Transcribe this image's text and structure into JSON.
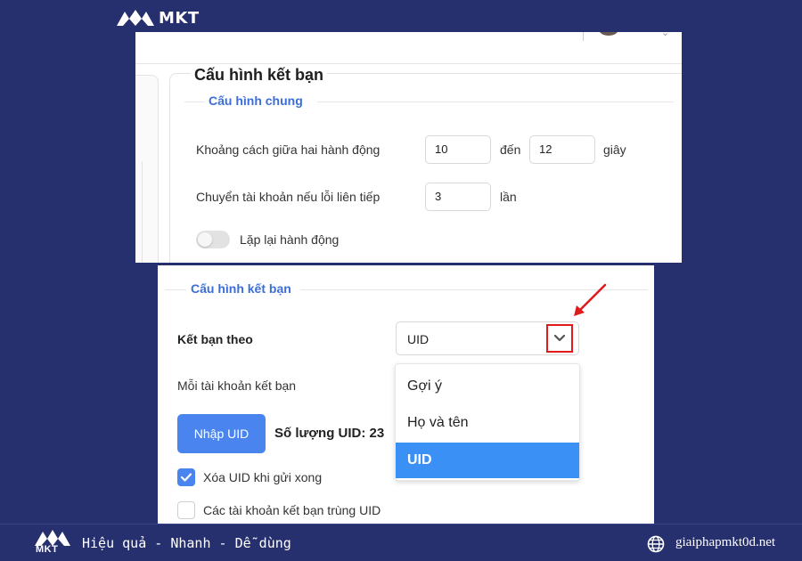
{
  "logo": {
    "brand": "MKT"
  },
  "config": {
    "title": "Cấu hình kết bạn",
    "general_section": "Cấu hình chung",
    "interval_label": "Khoảng cách giữa hai hành động",
    "interval_from": "10",
    "interval_sep": "đến",
    "interval_to": "12",
    "interval_unit": "giây",
    "switch_label": "Chuyển tài khoản nếu lỗi liên tiếp",
    "switch_value": "3",
    "switch_unit": "lần",
    "repeat_label": "Lặp lại hành động",
    "repeat_on": false
  },
  "friend": {
    "section": "Cấu hình kết bạn",
    "by_label": "Kết bạn theo",
    "by_value": "UID",
    "options": [
      {
        "label": "Gợi ý",
        "selected": false
      },
      {
        "label": "Họ và tên",
        "selected": false
      },
      {
        "label": "UID",
        "selected": true
      }
    ],
    "per_account_label": "Mỗi tài khoản kết bạn",
    "import_button": "Nhập UID",
    "uid_count": "Số lượng UID: 23",
    "delete_label": "Xóa UID khi gửi xong",
    "delete_checked": true,
    "dup_label": "Các tài khoản kết bạn trùng UID",
    "dup_checked": false
  },
  "footer": {
    "logo_text": "MKT",
    "slogan": "Hiệu quả - Nhanh - Dễ dùng",
    "website": "giaiphapmkt0d.net"
  },
  "colors": {
    "background": "#27306e",
    "accent": "#3b6ed8",
    "selected": "#3a90f5",
    "annotation": "#e0191b"
  }
}
